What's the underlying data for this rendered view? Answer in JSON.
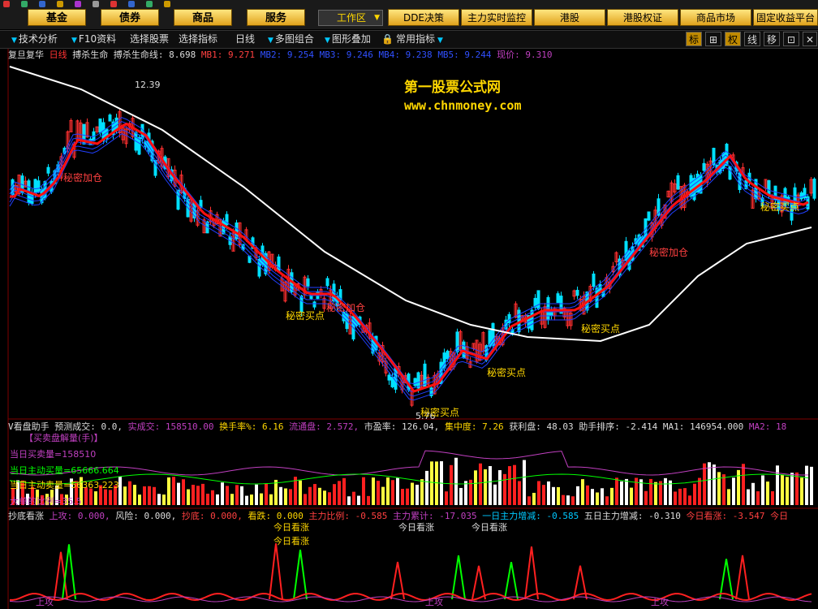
{
  "top_menu": {
    "buttons": [
      "基金",
      "债券",
      "商品",
      "服务"
    ],
    "workspace": "工作区",
    "right_buttons": [
      "DDE决策",
      "主力实时监控",
      "港股",
      "港股权证",
      "商品市场",
      "固定收益平台"
    ]
  },
  "toolbar": {
    "items": [
      "技术分析",
      "F10资料",
      "选择股票",
      "选择指标",
      "日线",
      "多图组合",
      "图形叠加",
      "常用指标"
    ],
    "right": [
      "标",
      "⊞",
      "权",
      "线",
      "移",
      "⊡"
    ]
  },
  "info": {
    "stock": "复旦复华",
    "period": "日线",
    "name1": "搏杀生命",
    "name2": "搏杀生命线:",
    "val": "8.698",
    "mb1": "MB1: 9.271",
    "mb2": "MB2: 9.254",
    "mb3": "MB3: 9.246",
    "mb4": "MB4: 9.238",
    "mb5": "MB5: 9.244",
    "price": "现价: 9.310"
  },
  "watermark": {
    "line1": "第一股票公式网",
    "line2": "www.chnmoney.com"
  },
  "price_labels": {
    "high": "12.39",
    "low": "5.76"
  },
  "signals": {
    "buy": "秘密买点",
    "add": "秘密加仓"
  },
  "volume_header": {
    "name": "V看盘助手",
    "forecast": "预测成交: 0.0,",
    "deal": "实成交: 158510.00",
    "turnover": "换手率%: 6.16",
    "float": "流通盘: 2.572,",
    "pe": "市盈率: 126.04,",
    "conc": "集中度: 7.26",
    "profit": "获利盘: 48.03",
    "rank": "助手排序: -2.414",
    "ma1": "MA1: 146954.000",
    "ma2": "MA2: 18"
  },
  "volume_labels": {
    "buysell": "【买卖盘解量(手)】",
    "sell": "当日买卖量=158510",
    "active_buy": "当日主动买量=65666.664",
    "active_sell": "当日主动卖量=56363.223",
    "big": "大单的比例=35.5"
  },
  "bottom_header": {
    "name": "抄底看涨",
    "up": "上攻: 0.000,",
    "risk": "风险: 0.000,",
    "bottom": "抄底: 0.000,",
    "look": "看跌: 0.000",
    "ratio": "主力比例: -0.585",
    "acc": "主力累计: -17.035",
    "one": "一日主力增减: -0.585",
    "five": "五日主力增减: -0.310",
    "today": "今日看涨: -3.547",
    "today2": "今日"
  },
  "bottom_labels": {
    "today_up": "今日看涨",
    "up": "上攻",
    "look": "看跌"
  }
}
